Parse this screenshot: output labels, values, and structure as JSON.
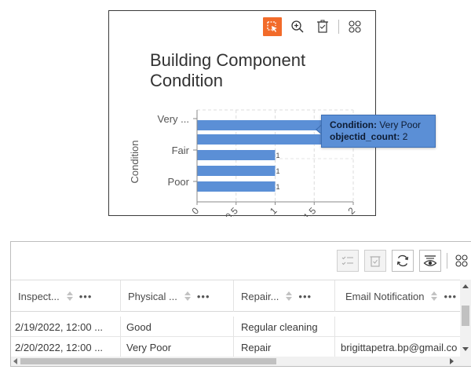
{
  "chart_card": {
    "title": "Building Component Condition",
    "toolbar": {
      "select_icon": "selection-icon",
      "zoom_icon": "zoom-to-icon",
      "clear_icon": "clear-selection-icon",
      "options_icon": "options-icon"
    },
    "tooltip": {
      "field_label": "Condition:",
      "field_value": "Very Poor",
      "count_label": "objectid_count:",
      "count_value": "2"
    },
    "accent_color": "#f26b2a",
    "bar_color": "#5b8fd6"
  },
  "chart_data": {
    "type": "bar",
    "orientation": "horizontal",
    "ylabel": "Condition",
    "xlabel": "",
    "categories": [
      "Very ...",
      "Very ...",
      "Fair",
      "Fair",
      "Poor"
    ],
    "y_tick_labels": [
      "Very ...",
      "Fair",
      "Poor"
    ],
    "values": [
      2,
      2,
      1,
      1,
      1
    ],
    "data_labels": [
      "2",
      "2",
      "1",
      "1",
      "1"
    ],
    "x_ticks": [
      "0",
      "0.5",
      "1",
      "1.5",
      "2"
    ],
    "xlim": [
      0,
      2
    ],
    "grid": true
  },
  "table_card": {
    "toolbar": {
      "show_selected_icon": "show-selected-icon",
      "clear_selection_icon": "clear-selection-icon",
      "refresh_icon": "refresh-icon",
      "toggle_columns_icon": "toggle-columns-icon",
      "options_icon": "options-icon"
    },
    "columns": [
      "Inspect...",
      "Physical ...",
      "Repair...",
      "Email Notification"
    ],
    "col_more": "•••",
    "rows": [
      [
        "2/19/2022, 12:00 ...",
        "Good",
        "Regular cleaning",
        ""
      ],
      [
        "2/20/2022, 12:00 ...",
        "Very Poor",
        "Repair",
        "brigittapetra.bp@gmail.co"
      ]
    ]
  }
}
